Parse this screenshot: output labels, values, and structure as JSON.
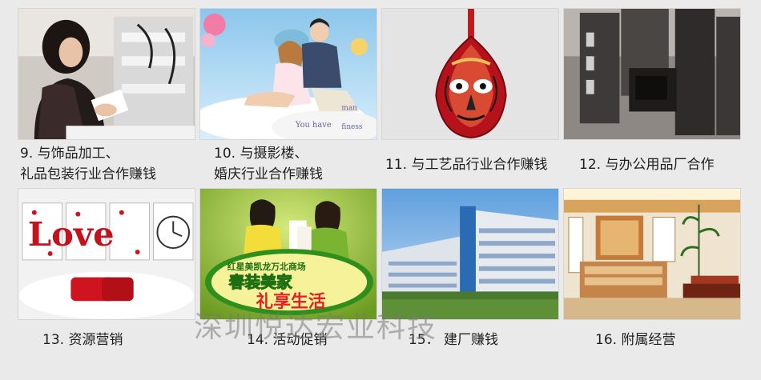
{
  "items": [
    {
      "number": "9.",
      "line1": "与饰品加工、",
      "line2": "礼品包装行业合作赚钱"
    },
    {
      "number": "10.",
      "line1": "与摄影楼、",
      "line2": "婚庆行业合作赚钱",
      "photo_text": [
        "You have",
        "man",
        "finess"
      ]
    },
    {
      "number": "11.",
      "line1": "与工艺品行业合作赚钱"
    },
    {
      "number": "12.",
      "line1": "与办公用品厂合作"
    },
    {
      "number": "13.",
      "line1": "资源营销",
      "photo_text": "Love"
    },
    {
      "number": "14.",
      "line1": "活动促销",
      "photo_text": [
        "红星美凯龙万北商场",
        "春装美家",
        "礼享生活"
      ]
    },
    {
      "number": "15．",
      "line1": "建厂赚钱"
    },
    {
      "number": "16.",
      "line1": "附属经营"
    }
  ],
  "watermark": "深圳悦达宏业科技",
  "colors": {
    "background": "#eaeaea",
    "caption_text": "#1e1e1e",
    "watermark": "#787878"
  }
}
